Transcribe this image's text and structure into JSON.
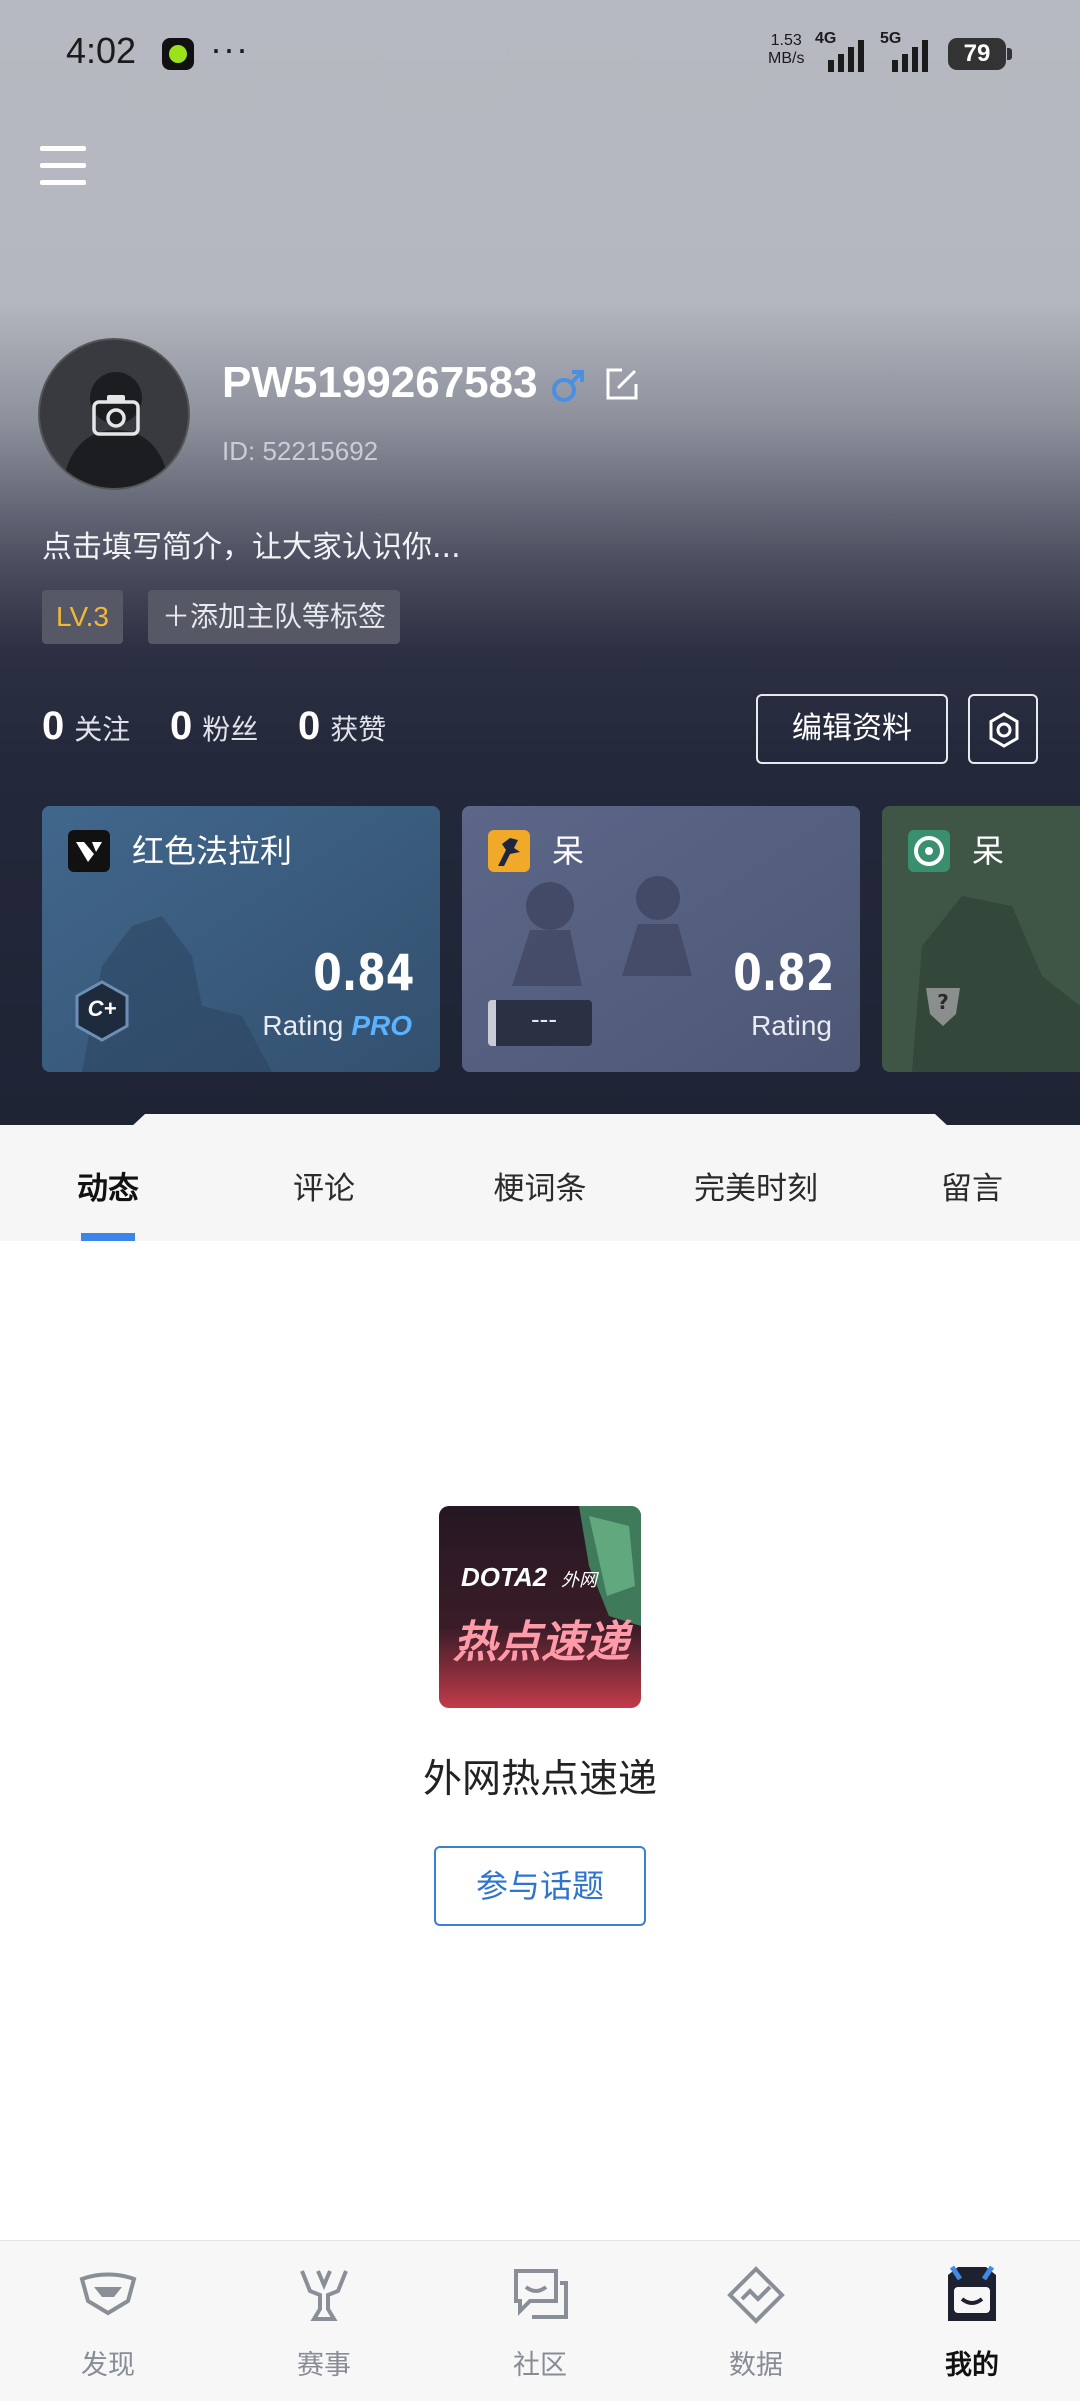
{
  "status_bar": {
    "time": "4:02",
    "more": "···",
    "speed_value": "1.53",
    "speed_unit": "MB/s",
    "net1": "4G",
    "net2": "5G",
    "battery": "79"
  },
  "profile": {
    "username": "PW5199267583",
    "user_id": "ID: 52215692",
    "bio": "点击填写简介，让大家认识你...",
    "level": "LV.3",
    "add_tag": "＋添加主队等标签",
    "gender_icon": "male-icon",
    "gender_color": "#4a90e2"
  },
  "stats": [
    {
      "num": "0",
      "label": "关注"
    },
    {
      "num": "0",
      "label": "粉丝"
    },
    {
      "num": "0",
      "label": "获赞"
    }
  ],
  "buttons": {
    "edit_profile": "编辑资料"
  },
  "cards": [
    {
      "name": "红色法拉利",
      "value": "0.84",
      "rating_label": "Rating",
      "badge": "PRO",
      "rank": "C+"
    },
    {
      "name": "呆",
      "value": "0.82",
      "rating_label": "Rating",
      "rank": "---"
    },
    {
      "name": "呆",
      "rank": "?"
    }
  ],
  "tabs": [
    "动态",
    "评论",
    "梗词条",
    "完美时刻",
    "留言"
  ],
  "topic": {
    "image_line1": "DOTA2",
    "image_line1b": "外网",
    "image_line2": "热点速递",
    "title": "外网热点速递",
    "join_button": "参与话题"
  },
  "bottom_nav": [
    {
      "label": "发现",
      "icon": "discover-icon"
    },
    {
      "label": "赛事",
      "icon": "trophy-icon"
    },
    {
      "label": "社区",
      "icon": "community-icon"
    },
    {
      "label": "数据",
      "icon": "data-icon"
    },
    {
      "label": "我的",
      "icon": "profile-icon"
    }
  ],
  "colors": {
    "accent": "#3a86ea",
    "level": "#f2b735",
    "pro": "#5bb2ff"
  }
}
